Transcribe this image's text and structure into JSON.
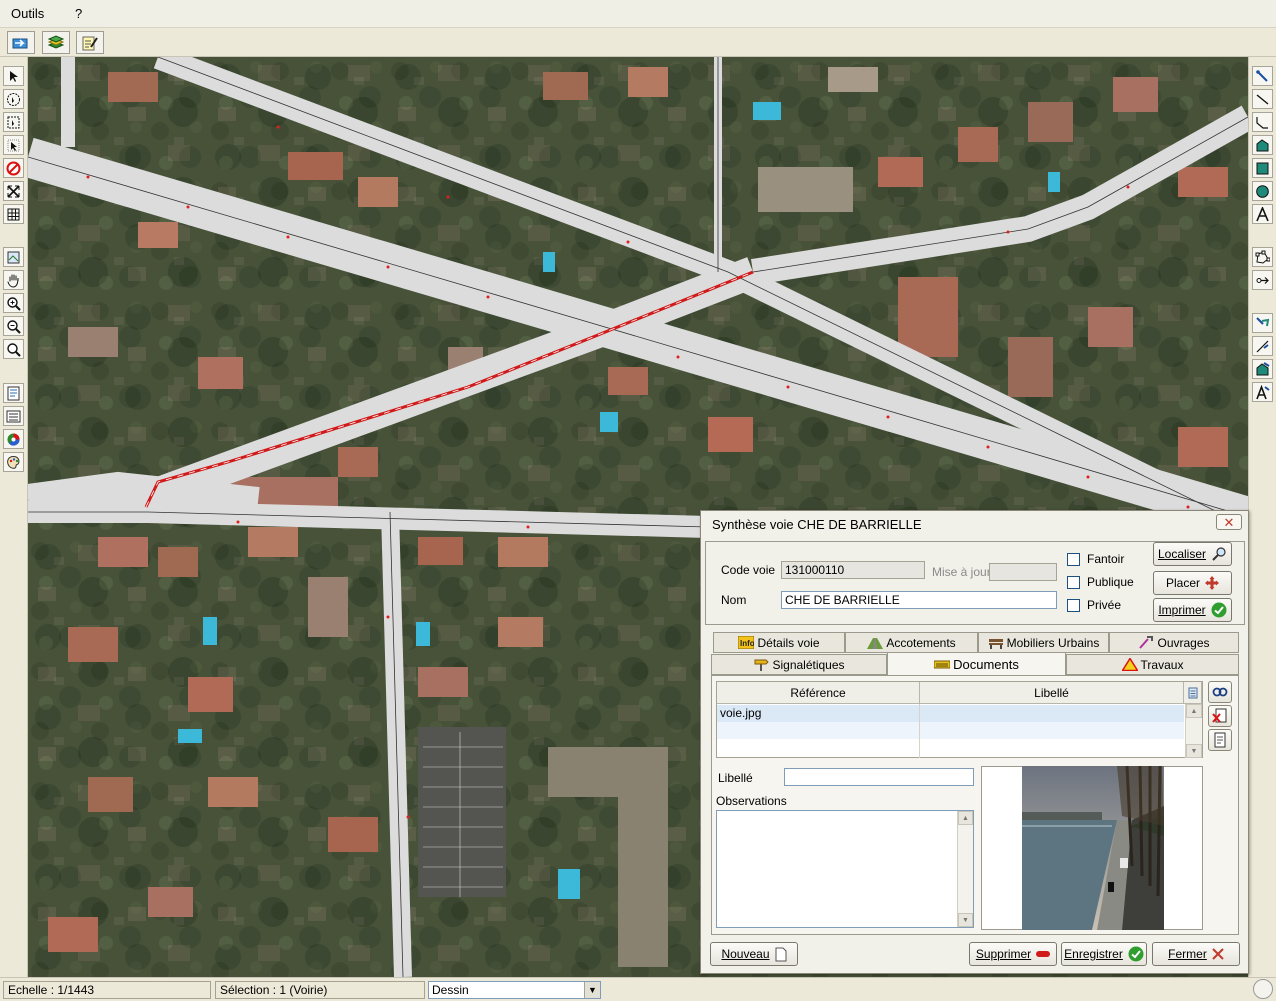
{
  "menu": [
    "Outils",
    "?"
  ],
  "toolbar_icons": [
    "export-icon",
    "layers-icon",
    "edit-form-icon"
  ],
  "left_tools": [
    "select-arrow-icon",
    "select-circle-icon",
    "select-rectangle-icon",
    "select-info-icon",
    "no-selection-icon",
    "extent-icon",
    "grid-icon",
    "map-export-icon",
    "pan-hand-icon",
    "zoom-in-icon",
    "zoom-out-icon",
    "zoom-icon",
    "report-icon",
    "list-icon",
    "color-wheel-icon",
    "palette-icon"
  ],
  "right_tools": [
    "draw-point-icon",
    "draw-line-icon",
    "draw-polyline-icon",
    "draw-polygon-icon",
    "draw-rectangle-icon",
    "draw-circle-icon",
    "draw-text-icon",
    "edit-vertices-icon",
    "move-icon",
    "select-object-icon",
    "edit-line-icon",
    "edit-shape-icon",
    "edit-text-icon"
  ],
  "status": {
    "scale": "Echelle : 1/1443",
    "selection": "Sélection : 1 (Voirie)",
    "layer_select": "Dessin"
  },
  "dialog": {
    "title": "Synthèse voie CHE DE BARRIELLE",
    "code_voie_label": "Code voie",
    "code_voie_value": "131000110",
    "mise_a_jour_label": "Mise à jour",
    "mise_a_jour_value": "",
    "nom_label": "Nom",
    "nom_value": "CHE DE BARRIELLE",
    "checkboxes": [
      "Fantoir",
      "Publique",
      "Privée"
    ],
    "buttons": {
      "localiser": "Localiser",
      "placer": "Placer",
      "imprimer": "Imprimer",
      "nouveau": "Nouveau",
      "supprimer": "Supprimer",
      "enregistrer": "Enregistrer",
      "fermer": "Fermer"
    },
    "tabs_row1": [
      "Détails voie",
      "Accotements",
      "Mobiliers Urbains",
      "Ouvrages"
    ],
    "tabs_row2": [
      "Signalétiques",
      "Documents",
      "Travaux"
    ],
    "active_tab": "Documents",
    "documents": {
      "columns": [
        "Référence",
        "Libellé"
      ],
      "rows": [
        {
          "reference": "voie.jpg",
          "libelle": ""
        }
      ],
      "libelle_label": "Libellé",
      "libelle_value": "",
      "observations_label": "Observations",
      "observations_value": ""
    }
  },
  "colors": {
    "road": "#dcdcdc",
    "selected_road": "#d11a1a",
    "aerial_base": "#3e4a32",
    "dialog_bg": "#f1f0e9"
  }
}
